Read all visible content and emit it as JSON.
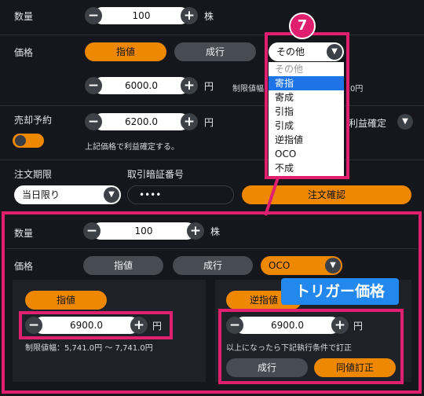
{
  "top": {
    "quantity": {
      "label": "数量",
      "value": "100",
      "unit": "株"
    },
    "price": {
      "label": "価格",
      "limit_button": "指値",
      "market_button": "成行",
      "order_type_selected": "その他",
      "limit_value": "6000.0",
      "unit": "円",
      "limit_range_partial": "制限値幅",
      "limit_range_suffix": "0円"
    },
    "sell_reservation": {
      "label": "売却予約",
      "value": "6200.0",
      "unit": "円",
      "note": "上記価格で利益確定する。",
      "dropdown_selected": "利益確定"
    },
    "order_period": {
      "label": "注文期限",
      "selected": "当日限り"
    },
    "password": {
      "label": "取引暗証番号",
      "value": "••••"
    },
    "confirm_button": "注文確認"
  },
  "dropdown": {
    "options": [
      "その他",
      "寄指",
      "寄成",
      "引指",
      "引成",
      "逆指値",
      "OCO",
      "不成"
    ],
    "selected_index": 1
  },
  "callout_number": "7",
  "bottom": {
    "quantity": {
      "label": "数量",
      "value": "100",
      "unit": "株"
    },
    "price": {
      "label": "価格",
      "limit_button": "指値",
      "market_button": "成行",
      "order_type_selected": "OCO"
    },
    "left_panel": {
      "tag": "指値",
      "value": "6900.0",
      "unit": "円",
      "range": "制限値幅：5,741.0円 ～ 7,741.0円"
    },
    "right_panel": {
      "tag": "逆指値",
      "value": "6900.0",
      "unit": "円",
      "note": "以上になったら下記執行条件で訂正",
      "market_button": "成行",
      "limit_button": "同値訂正"
    }
  },
  "trigger_banner": "トリガー価格",
  "colors": {
    "accent_orange": "#ee8800",
    "highlight_pink": "#e0206e",
    "banner_blue": "#2288ee",
    "selected_blue": "#1e73e6"
  },
  "icons": [
    "minus-icon",
    "plus-icon",
    "chevron-down-icon"
  ]
}
